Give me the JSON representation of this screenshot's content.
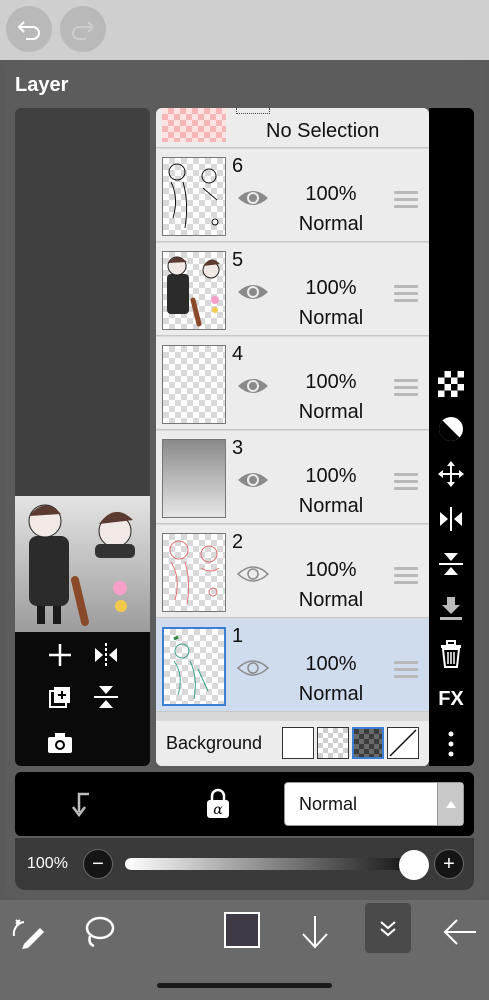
{
  "panel": {
    "title": "Layer"
  },
  "no_selection": {
    "label": "No Selection"
  },
  "layers": [
    {
      "number": "6",
      "opacity": "100%",
      "mode": "Normal",
      "visible": true,
      "selected": false
    },
    {
      "number": "5",
      "opacity": "100%",
      "mode": "Normal",
      "visible": true,
      "selected": false
    },
    {
      "number": "4",
      "opacity": "100%",
      "mode": "Normal",
      "visible": true,
      "selected": false
    },
    {
      "number": "3",
      "opacity": "100%",
      "mode": "Normal",
      "visible": true,
      "selected": false
    },
    {
      "number": "2",
      "opacity": "100%",
      "mode": "Normal",
      "visible": false,
      "selected": false
    },
    {
      "number": "1",
      "opacity": "100%",
      "mode": "Normal",
      "visible": false,
      "selected": true
    }
  ],
  "background": {
    "label": "Background",
    "options": [
      "white",
      "checker-light",
      "checker-dark",
      "none"
    ],
    "selected": "checker-dark"
  },
  "blend": {
    "selected": "Normal"
  },
  "opacity": {
    "label": "100%",
    "minus": "−",
    "plus": "+",
    "value": 1.0
  },
  "right_toolbar": {
    "fx_label": "FX"
  },
  "colors": {
    "accent": "#3a7fd4",
    "selected_row": "#cfdcee",
    "current_color": "#3f3a45"
  },
  "icons": [
    "undo-icon",
    "redo-icon",
    "checker-icon",
    "contrast-icon",
    "move-icon",
    "flip-horizontal-icon",
    "flip-vertical-icon",
    "merge-down-icon",
    "trash-icon",
    "fx-icon",
    "more-icon",
    "add-layer-icon",
    "duplicate-layer-icon",
    "camera-icon",
    "clipping-icon",
    "alpha-lock-icon",
    "transform-tool-icon",
    "lasso-icon",
    "color-swatch",
    "down-arrow-icon",
    "collapse-icon",
    "back-arrow-icon"
  ]
}
